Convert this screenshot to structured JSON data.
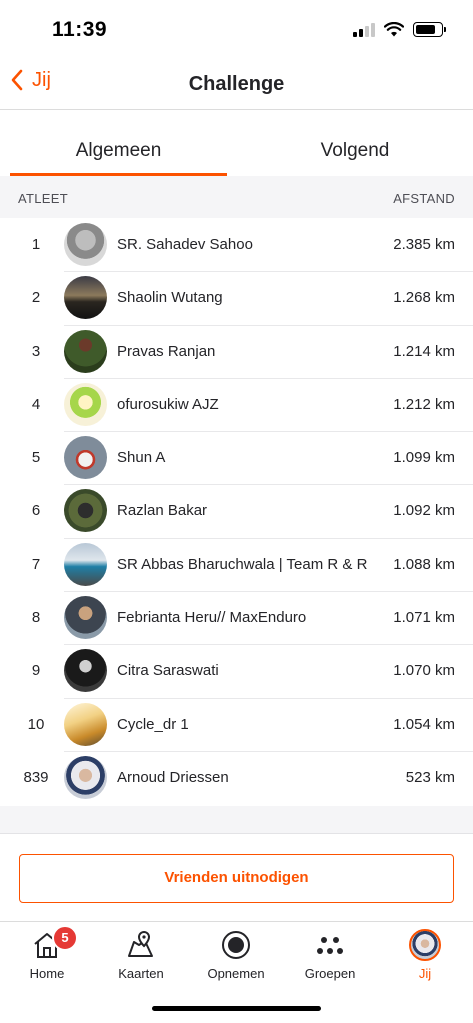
{
  "status_bar": {
    "time": "11:39"
  },
  "nav": {
    "back_label": "Jij",
    "title": "Challenge"
  },
  "tabs": [
    {
      "label": "Algemeen",
      "active": true
    },
    {
      "label": "Volgend",
      "active": false
    }
  ],
  "list_header": {
    "athlete": "ATLEET",
    "distance": "AFSTAND"
  },
  "athletes": [
    {
      "rank": "1",
      "name": "SR. Sahadev Sahoo",
      "distance": "2.385 km"
    },
    {
      "rank": "2",
      "name": "Shaolin Wutang",
      "distance": "1.268 km"
    },
    {
      "rank": "3",
      "name": "Pravas Ranjan",
      "distance": "1.214 km"
    },
    {
      "rank": "4",
      "name": "ofurosukiw AJZ",
      "distance": "1.212 km"
    },
    {
      "rank": "5",
      "name": "Shun A",
      "distance": "1.099 km"
    },
    {
      "rank": "6",
      "name": "Razlan Bakar",
      "distance": "1.092 km"
    },
    {
      "rank": "7",
      "name": "SR Abbas Bharuchwala | Team R & R",
      "distance": "1.088 km"
    },
    {
      "rank": "8",
      "name": "Febrianta Heru// MaxEnduro",
      "distance": "1.071 km"
    },
    {
      "rank": "9",
      "name": "Citra Saraswati",
      "distance": "1.070 km"
    },
    {
      "rank": "10",
      "name": "Cycle_dr 1",
      "distance": "1.054 km"
    },
    {
      "rank": "839",
      "name": "Arnoud Driessen",
      "distance": "523 km"
    }
  ],
  "invite_button": "Vrienden uitnodigen",
  "tabbar": {
    "items": [
      {
        "label": "Home",
        "icon": "home-icon"
      },
      {
        "label": "Kaarten",
        "icon": "map-icon"
      },
      {
        "label": "Opnemen",
        "icon": "record-icon"
      },
      {
        "label": "Groepen",
        "icon": "groups-icon"
      },
      {
        "label": "Jij",
        "icon": "profile-avatar-icon"
      }
    ],
    "home_badge": "5"
  },
  "colors": {
    "accent": "#fc5200",
    "badge": "#e53935",
    "text": "#242428"
  }
}
